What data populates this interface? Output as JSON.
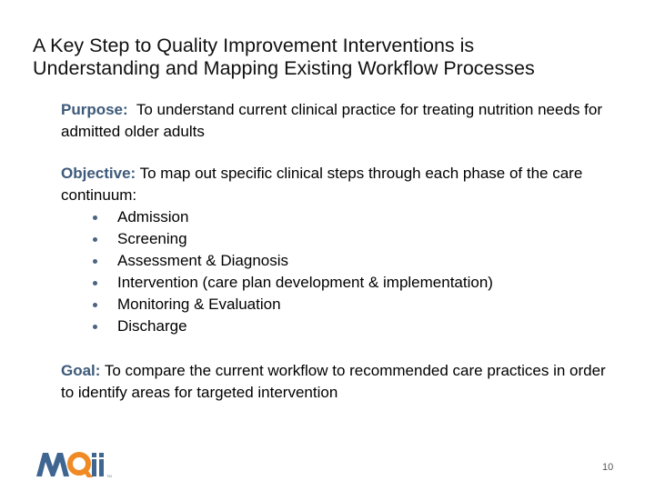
{
  "colors": {
    "label": "#3d5a7a",
    "bullet": "#4a6380",
    "logo_blue": "#3f6690",
    "logo_orange": "#f08a24"
  },
  "title": {
    "line1": "A Key Step to Quality Improvement Interventions is",
    "line2": "Understanding and Mapping Existing Workflow Processes"
  },
  "purpose": {
    "label": "Purpose:",
    "text": "  To understand current clinical practice for treating nutrition needs for admitted older adults"
  },
  "objective": {
    "label": "Objective:",
    "text": " To map out specific clinical steps through each phase of the care continuum:",
    "phases": [
      "Admission",
      "Screening",
      "Assessment & Diagnosis",
      "Intervention (care plan development & implementation)",
      "Monitoring & Evaluation",
      "Discharge"
    ]
  },
  "goal": {
    "label": "Goal:",
    "text": " To compare the current workflow to recommended care practices in order to identify areas for targeted intervention"
  },
  "footer": {
    "logo_text": "MQii",
    "logo_letters": [
      "M",
      "Q",
      "ii"
    ],
    "trademark": "TM",
    "page_number": "10"
  }
}
